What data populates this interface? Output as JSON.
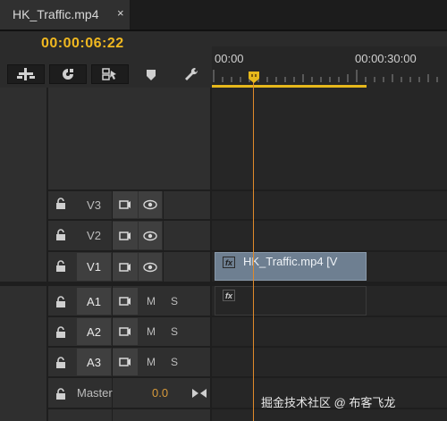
{
  "tab": {
    "title": "HK_Traffic.mp4",
    "close": "×"
  },
  "timecode": "00:00:06:22",
  "toolbar": [
    "insert-edit-tool",
    "snap-magnet-tool",
    "linked-selection-tool",
    "add-marker-tool",
    "settings-wrench-tool"
  ],
  "ruler": {
    "start": "00:00",
    "end": "00:00:30:00"
  },
  "video_tracks": [
    {
      "name": "V3",
      "locked": true
    },
    {
      "name": "V2",
      "locked": true
    },
    {
      "name": "V1",
      "locked": true,
      "clip": "HK_Traffic.mp4 [V",
      "fx": "fx"
    }
  ],
  "audio_tracks": [
    {
      "name": "A1",
      "m": "M",
      "s": "S",
      "clip_fx": "fx"
    },
    {
      "name": "A2",
      "m": "M",
      "s": "S"
    },
    {
      "name": "A3",
      "m": "M",
      "s": "S"
    }
  ],
  "master": {
    "label": "Master",
    "value": "0.0"
  },
  "watermark": "掘金技术社区 @ 布客飞龙",
  "colors": {
    "timecode": "#f0b820",
    "playhead": "#e08a2a",
    "clip": "#6e7f91"
  }
}
